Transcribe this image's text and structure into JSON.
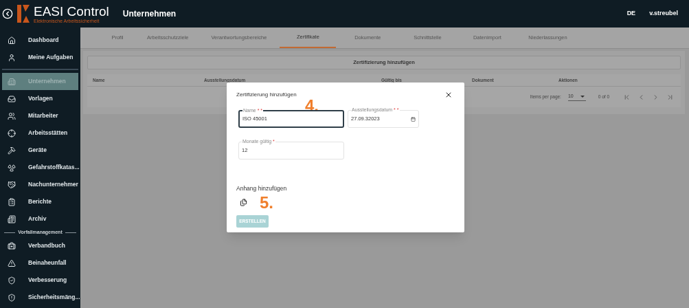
{
  "header": {
    "logo_title": "EASI Control",
    "logo_subtitle": "Elektronische Arbeitssicherheit",
    "page_title": "Unternehmen",
    "language": "DE",
    "user": "v.streubel"
  },
  "sidebar": {
    "items": [
      {
        "label": "Dashboard",
        "selected": false
      },
      {
        "label": "Meine Aufgaben",
        "selected": false
      },
      {
        "kind": "divider"
      },
      {
        "label": "Unternehmen",
        "selected": true
      },
      {
        "label": "Vorlagen",
        "selected": false
      },
      {
        "label": "Mitarbeiter",
        "selected": false
      },
      {
        "label": "Arbeitsstätten",
        "selected": false
      },
      {
        "label": "Geräte",
        "selected": false
      },
      {
        "label": "Gefahrstoffkatas...",
        "selected": false
      },
      {
        "label": "Nachunternehmer",
        "selected": false
      },
      {
        "label": "Berichte",
        "selected": false
      },
      {
        "label": "Archiv",
        "selected": false
      },
      {
        "kind": "section",
        "label": "Vorfallmanagement"
      },
      {
        "label": "Verbandbuch",
        "selected": false
      },
      {
        "label": "Beinaheunfall",
        "selected": false
      },
      {
        "label": "Verbesserung",
        "selected": false
      },
      {
        "label": "Sicherheitsmäng...",
        "selected": false
      }
    ]
  },
  "tabs": [
    {
      "label": "Profil",
      "selected": false
    },
    {
      "label": "Arbeitsschutzziele",
      "selected": false
    },
    {
      "label": "Verantwortungsbereiche",
      "selected": false
    },
    {
      "label": "Zertifikate",
      "selected": true
    },
    {
      "label": "Dokumente",
      "selected": false
    },
    {
      "label": "Schnittstelle",
      "selected": false
    },
    {
      "label": "Datenimport",
      "selected": false
    },
    {
      "label": "Niederlassungen",
      "selected": false
    }
  ],
  "add_button": "Zertifizierung hinzufügen",
  "table": {
    "columns": [
      "Name",
      "Ausstellungsdatum",
      "Gültig bis",
      "Dokument",
      "Aktionen"
    ]
  },
  "paginator": {
    "label": "Items per page:",
    "page_size": "10",
    "range": "0 of 0"
  },
  "dialog": {
    "title": "Zertifizierung hinzufügen",
    "fields": [
      {
        "label": "Name",
        "required_marks": "* *",
        "value": "ISO 45001",
        "focused": true
      },
      {
        "label": "Ausstellungsdatum",
        "required_marks": "* *",
        "value": "27.09.32023",
        "focused": false,
        "kind": "date"
      },
      {
        "label": "Monate gültig",
        "required_marks": "*",
        "value": "12",
        "focused": false
      }
    ],
    "attachment_label": "Anhang hinzufügen",
    "submit": "ERSTELLEN",
    "submit_disabled": true
  },
  "annotations": [
    {
      "label": "4."
    },
    {
      "label": "5."
    }
  ]
}
